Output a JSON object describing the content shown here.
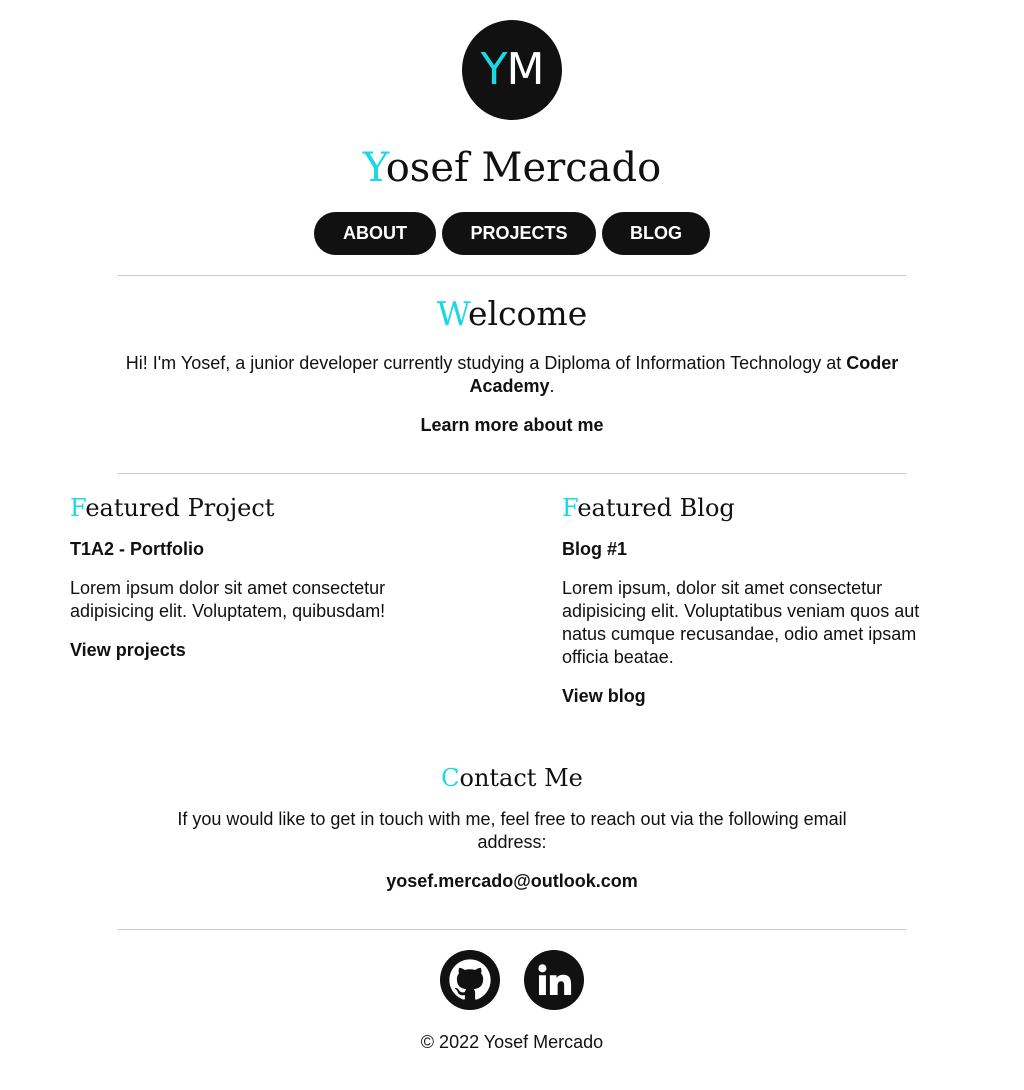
{
  "logo": {
    "letter1": "Y",
    "letter2": "M"
  },
  "site_title": {
    "first": "Y",
    "rest": "osef Mercado"
  },
  "nav": [
    {
      "label": "ABOUT"
    },
    {
      "label": "PROJECTS"
    },
    {
      "label": "BLOG"
    }
  ],
  "welcome": {
    "heading_first": "W",
    "heading_rest": "elcome",
    "text_before": "Hi! I'm Yosef, a junior developer currently studying a Diploma of Information Technology at",
    "text_bold": "Coder Academy",
    "text_after": ".",
    "link": "Learn more about me"
  },
  "featured_project": {
    "heading_first": "F",
    "heading_rest": "eatured Project",
    "title": "T1A2 - Portfolio",
    "text": "Lorem ipsum dolor sit amet consectetur adipisicing elit. Voluptatem, quibusdam!",
    "link": "View projects"
  },
  "featured_blog": {
    "heading_first": "F",
    "heading_rest": "eatured Blog",
    "title": "Blog #1",
    "text": "Lorem ipsum, dolor sit amet consectetur adipisicing elit. Voluptatibus veniam quos aut natus cumque recusandae, odio amet ipsam officia beatae.",
    "link": "View blog"
  },
  "contact": {
    "heading_first": "C",
    "heading_rest": "ontact Me",
    "text": "If you would like to get in touch with me, feel free to reach out via the following email address:",
    "email": "yosef.mercado@outlook.com"
  },
  "socials": [
    {
      "icon": "github-icon"
    },
    {
      "icon": "linkedin-icon"
    }
  ],
  "footer": {
    "copyright": "© 2022 Yosef Mercado"
  },
  "colors": {
    "accent": "#1ad8e6",
    "dark": "#111111",
    "background": "#ffffff",
    "rule": "#c8c8c8"
  }
}
